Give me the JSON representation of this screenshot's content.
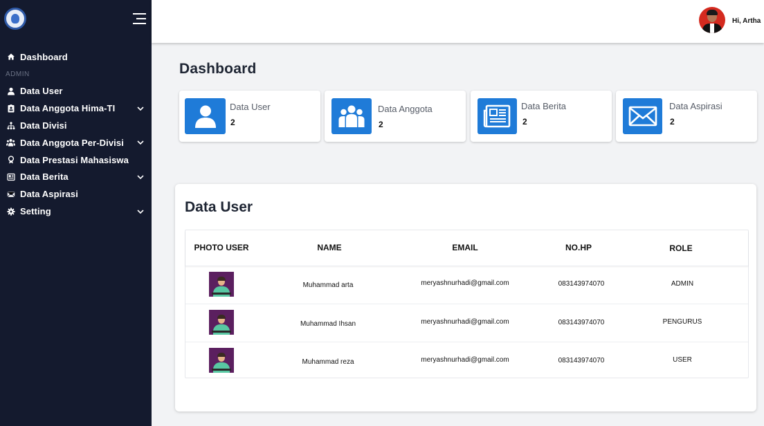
{
  "user": {
    "greeting": "Hi, Artha"
  },
  "sidebar": {
    "section_admin": "ADMIN",
    "items": [
      {
        "label": "Dashboard",
        "icon": "home-icon",
        "has_submenu": false
      },
      {
        "label": "Data User",
        "icon": "user-icon",
        "has_submenu": false
      },
      {
        "label": "Data Anggota Hima-TI",
        "icon": "id-badge-icon",
        "has_submenu": true
      },
      {
        "label": "Data Divisi",
        "icon": "sitemap-icon",
        "has_submenu": false
      },
      {
        "label": "Data Anggota Per-Divisi",
        "icon": "users-icon",
        "has_submenu": true
      },
      {
        "label": "Data Prestasi Mahasiswa",
        "icon": "award-icon",
        "has_submenu": false
      },
      {
        "label": "Data Berita",
        "icon": "newspaper-icon",
        "has_submenu": true
      },
      {
        "label": "Data Aspirasi",
        "icon": "envelope-icon",
        "has_submenu": false
      },
      {
        "label": "Setting",
        "icon": "gear-icon",
        "has_submenu": true
      }
    ]
  },
  "main": {
    "title": "Dashboard",
    "cards": [
      {
        "title": "Data User",
        "value": "2",
        "icon": "user-icon"
      },
      {
        "title": "Data Anggota",
        "value": "2",
        "icon": "users-icon"
      },
      {
        "title": "Data Berita",
        "value": "2",
        "icon": "newspaper-icon"
      },
      {
        "title": "Data Aspirasi",
        "value": "2",
        "icon": "envelope-icon"
      }
    ],
    "panel": {
      "title": "Data User",
      "columns": [
        "PHOTO USER",
        "NAME",
        "EMAIL",
        "NO.HP",
        "ROLE"
      ],
      "rows": [
        {
          "name": "Muhammad arta",
          "email": "meryashnurhadi@gmail.com",
          "phone": "083143974070",
          "role": "ADMIN"
        },
        {
          "name": "Muhammad Ihsan",
          "email": "meryashnurhadi@gmail.com",
          "phone": "083143974070",
          "role": "PENGURUS"
        },
        {
          "name": "Muhammad reza",
          "email": "meryashnurhadi@gmail.com",
          "phone": "083143974070",
          "role": "USER"
        }
      ]
    }
  },
  "colors": {
    "sidebar_bg": "#141a2e",
    "accent": "#1f7bd8",
    "page_bg": "#f2f3f5"
  }
}
